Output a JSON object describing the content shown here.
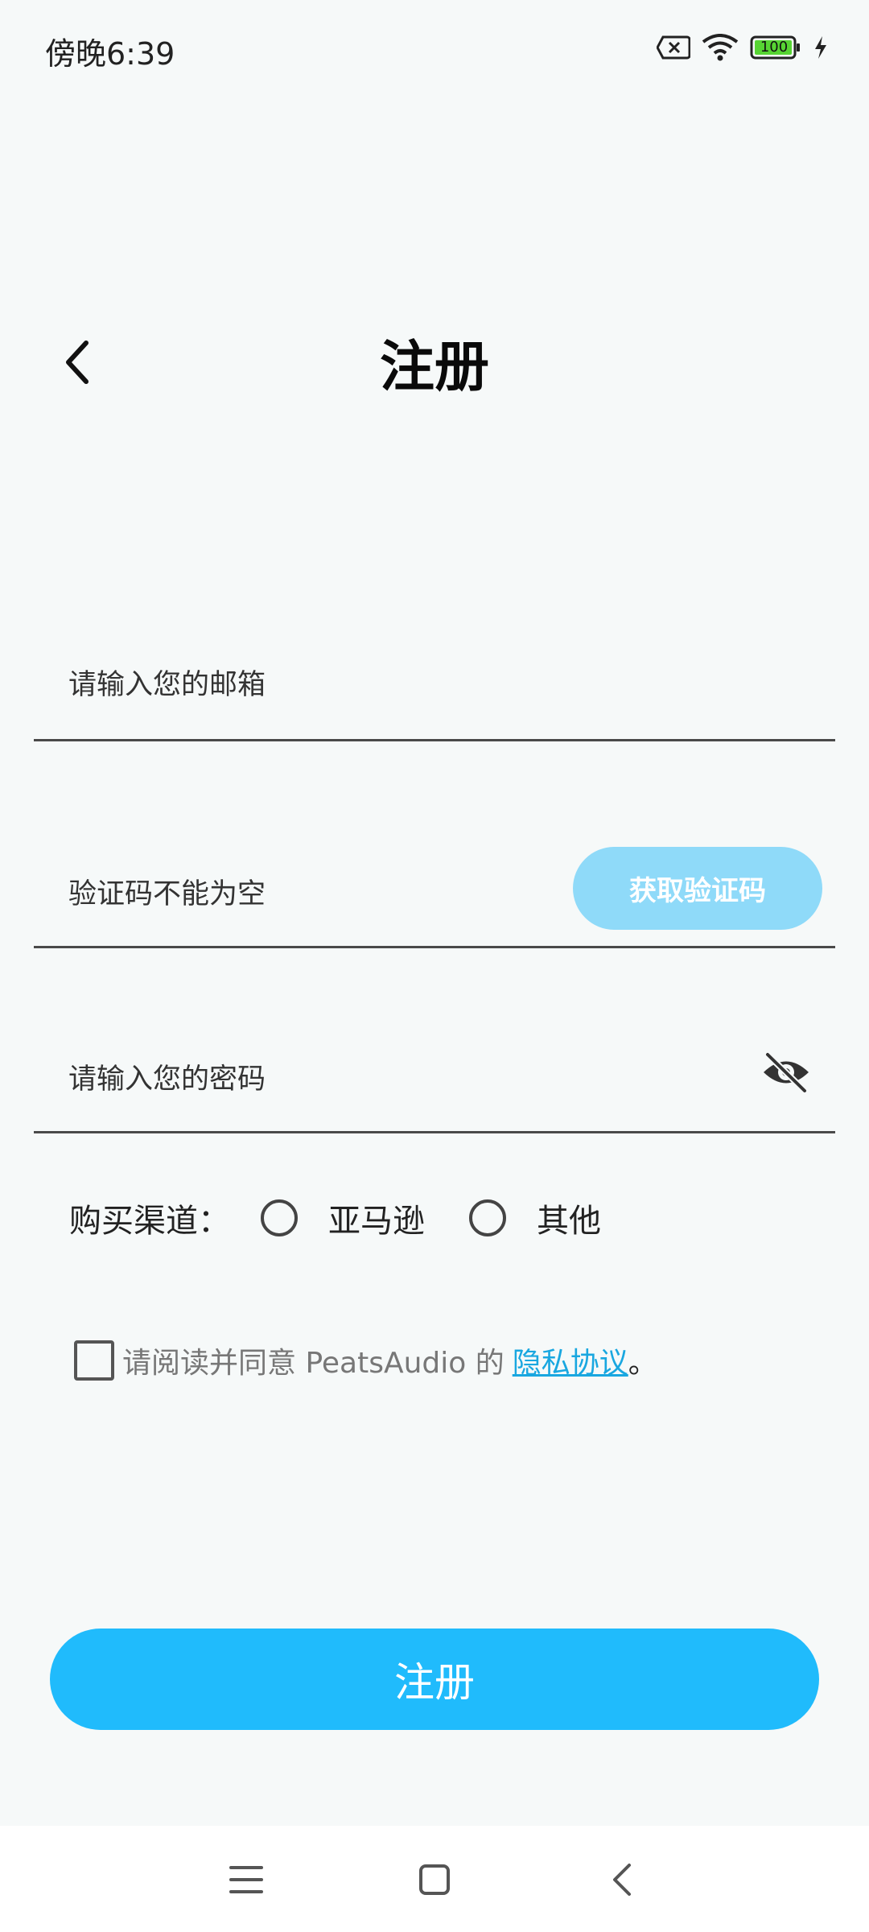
{
  "status_bar": {
    "time": "傍晚6:39",
    "battery": "100"
  },
  "header": {
    "title": "注册"
  },
  "form": {
    "email_placeholder": "请输入您的邮箱",
    "code_placeholder": "验证码不能为空",
    "get_code_label": "获取验证码",
    "password_placeholder": "请输入您的密码"
  },
  "channel": {
    "label": "购买渠道：",
    "options": [
      "亚马逊",
      "其他"
    ]
  },
  "agreement": {
    "text": "请阅读并同意 PeatsAudio 的",
    "link": "隐私协议",
    "suffix": "。"
  },
  "register_button": "注册",
  "colors": {
    "accent": "#20bbfc",
    "accent_light": "#8fdaf9",
    "link": "#19a7e0"
  }
}
